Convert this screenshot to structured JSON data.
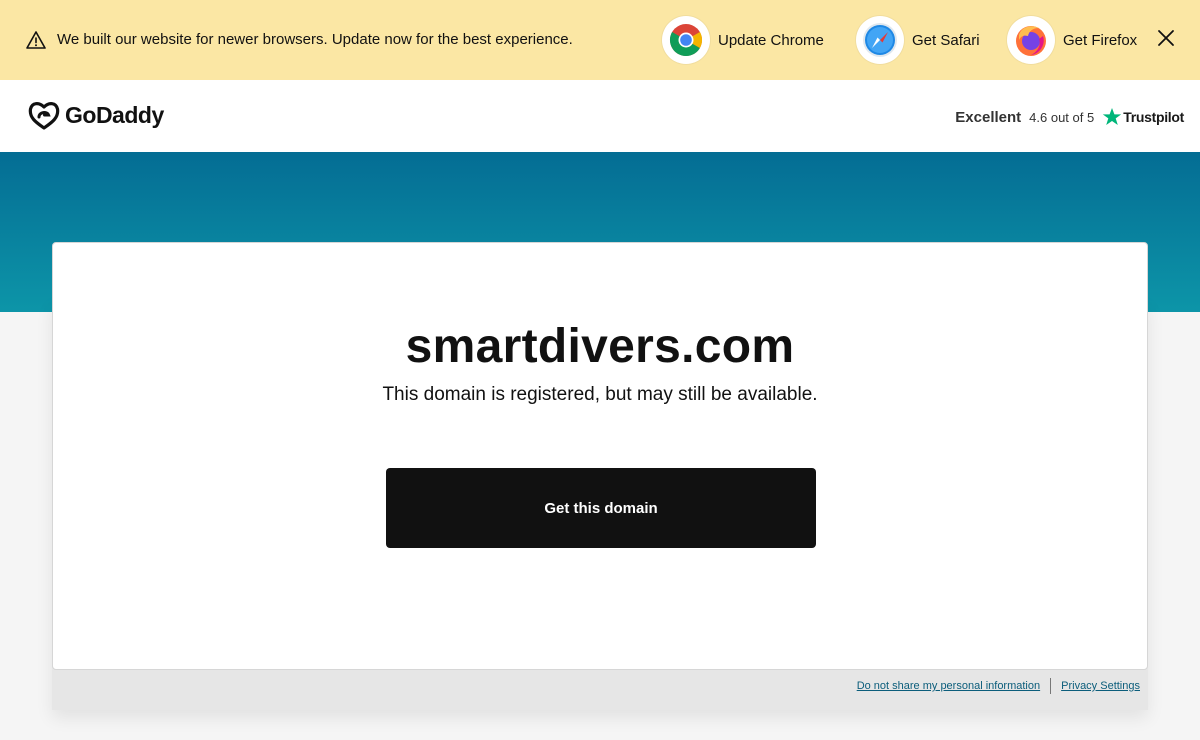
{
  "banner": {
    "message": "We built our website for newer browsers. Update now for the best experience.",
    "browsers": [
      {
        "label": "Update Chrome",
        "icon": "chrome-icon"
      },
      {
        "label": "Get Safari",
        "icon": "safari-icon"
      },
      {
        "label": "Get Firefox",
        "icon": "firefox-icon"
      }
    ],
    "close_icon": "close-icon",
    "background": "#fbe7a4"
  },
  "header": {
    "logo_text": "GoDaddy",
    "trust": {
      "rating_word": "Excellent",
      "score": "4.6 out of 5",
      "brand": "Trustpilot",
      "star_color": "#00b67a"
    }
  },
  "hero": {
    "gradient_top": "#046d94",
    "gradient_bottom": "#0d95a8"
  },
  "card": {
    "domain": "smartdivers.com",
    "status": "This domain is registered, but may still be available.",
    "cta_label": "Get this domain"
  },
  "footer": {
    "links": [
      {
        "label": "Do not share my personal information"
      },
      {
        "label": "Privacy Settings"
      }
    ]
  }
}
